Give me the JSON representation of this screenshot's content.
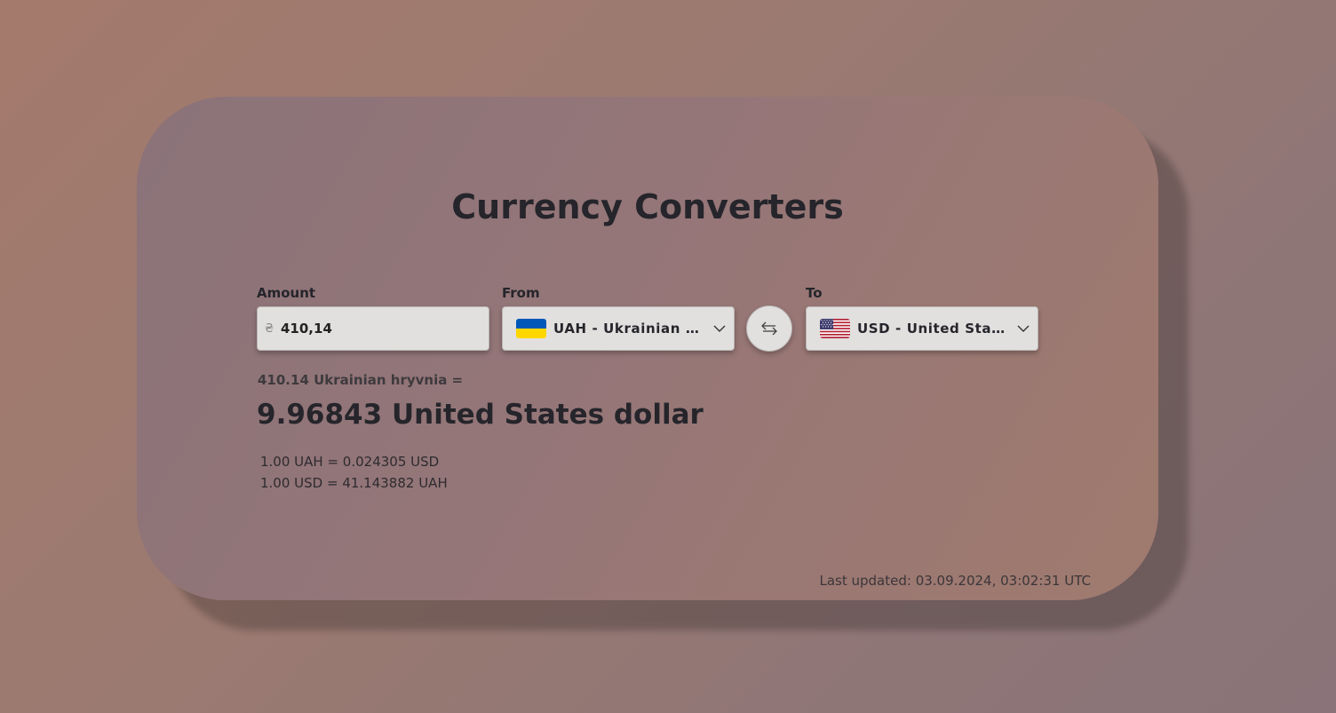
{
  "title": "Currency Converters",
  "amount": {
    "label": "Amount",
    "symbol": "₴",
    "value": "410,14"
  },
  "from": {
    "label": "From",
    "selected": "UAH - Ukrainian hryvnia",
    "flag_icon": "ukraine-flag-icon"
  },
  "to": {
    "label": "To",
    "selected": "USD - United States dollar",
    "flag_icon": "usa-flag-icon"
  },
  "swap_icon": "swap-arrows-icon",
  "result": {
    "from_text": "410.14 Ukrainian hryvnia =",
    "to_text": "9.96843 United States dollar"
  },
  "rates": {
    "line1": "1.00 UAH = 0.024305 USD",
    "line2": "1.00 USD = 41.143882 UAH"
  },
  "last_updated": "Last updated: 03.09.2024, 03:02:31 UTC",
  "colors": {
    "ukraine_blue": "#0057b7",
    "ukraine_yellow": "#ffd700"
  }
}
